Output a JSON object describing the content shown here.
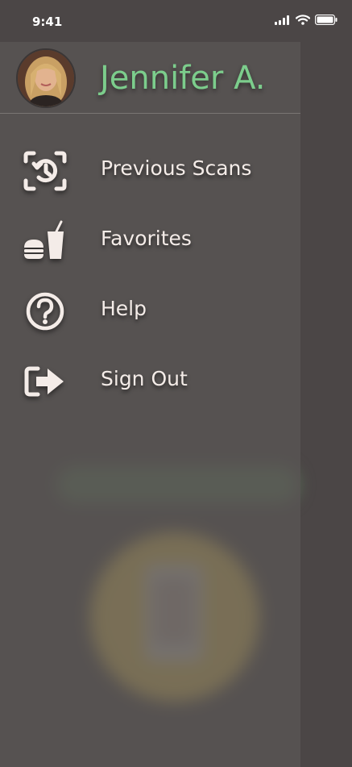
{
  "status_bar": {
    "time": "9:41",
    "icons": [
      "signal-icon",
      "wifi-icon",
      "battery-icon"
    ]
  },
  "drawer": {
    "user": {
      "name": "Jennifer A.",
      "avatar": "avatar-photo"
    },
    "items": [
      {
        "label": "Previous Scans",
        "icon": "history-scan-icon"
      },
      {
        "label": "Favorites",
        "icon": "food-drink-icon"
      },
      {
        "label": "Help",
        "icon": "help-icon"
      },
      {
        "label": "Sign Out",
        "icon": "sign-out-icon"
      }
    ]
  },
  "colors": {
    "accent": "#7ccd8c",
    "drawer_bg": "#5a5654",
    "text": "#f4ece8",
    "background": "#4b4646"
  }
}
